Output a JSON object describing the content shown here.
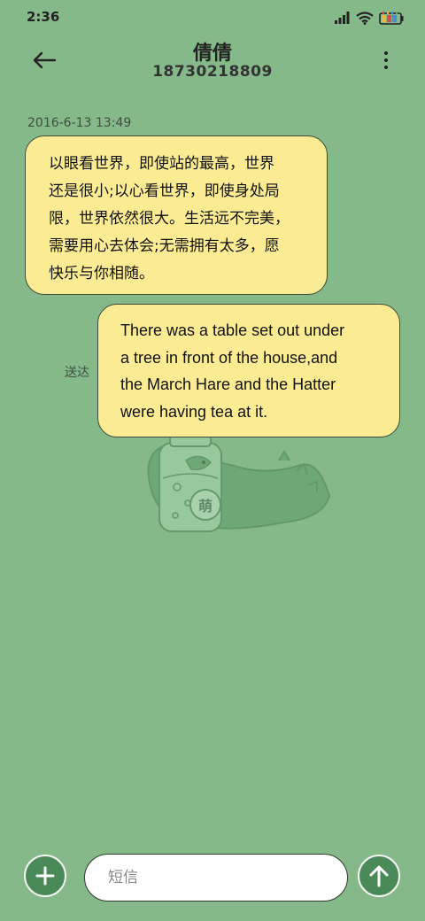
{
  "status_bar": {
    "time": "2:36",
    "icons": [
      "signal-icon",
      "wifi-icon",
      "battery-icon"
    ]
  },
  "header": {
    "contact_name": "倩倩",
    "contact_number": "18730218809",
    "back_icon": "back-arrow-icon",
    "more_icon": "more-vertical-icon"
  },
  "conversation": {
    "timestamp": "2016-6-13 13:49",
    "messages": [
      {
        "direction": "incoming",
        "lines": [
          "以眼看世界，即使站的最高，世界",
          "还是很小;以心看世界，即使身处局",
          "限，世界依然很大。生活远不完美，",
          "需要用心去体会;无需拥有太多，愿",
          "快乐与你相随。"
        ]
      },
      {
        "direction": "outgoing",
        "status": "送达",
        "lines": [
          "There was a table set out under",
          "a tree in front of the house,and",
          "the March Hare and the Hatter",
          "were having tea at it."
        ]
      }
    ],
    "wallpaper_badge": "萌"
  },
  "composer": {
    "placeholder": "短信",
    "value": "",
    "add_icon": "plus-icon",
    "send_icon": "send-arrow-icon"
  },
  "colors": {
    "background": "#85b98a",
    "bubble": "#fbec94",
    "button": "#4a8a58"
  }
}
